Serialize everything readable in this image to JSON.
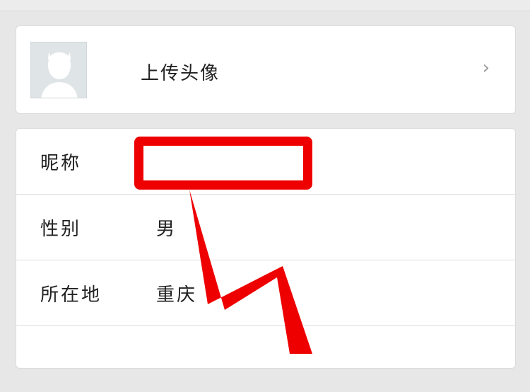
{
  "profile": {
    "upload_avatar_label": "上传头像",
    "chevron_glyph": "›"
  },
  "fields": [
    {
      "label": "昵称",
      "value": ""
    },
    {
      "label": "性别",
      "value": "男"
    },
    {
      "label": "所在地",
      "value": "重庆"
    },
    {
      "label": "",
      "value": ""
    }
  ],
  "annotation": {
    "color": "#ee0000"
  }
}
